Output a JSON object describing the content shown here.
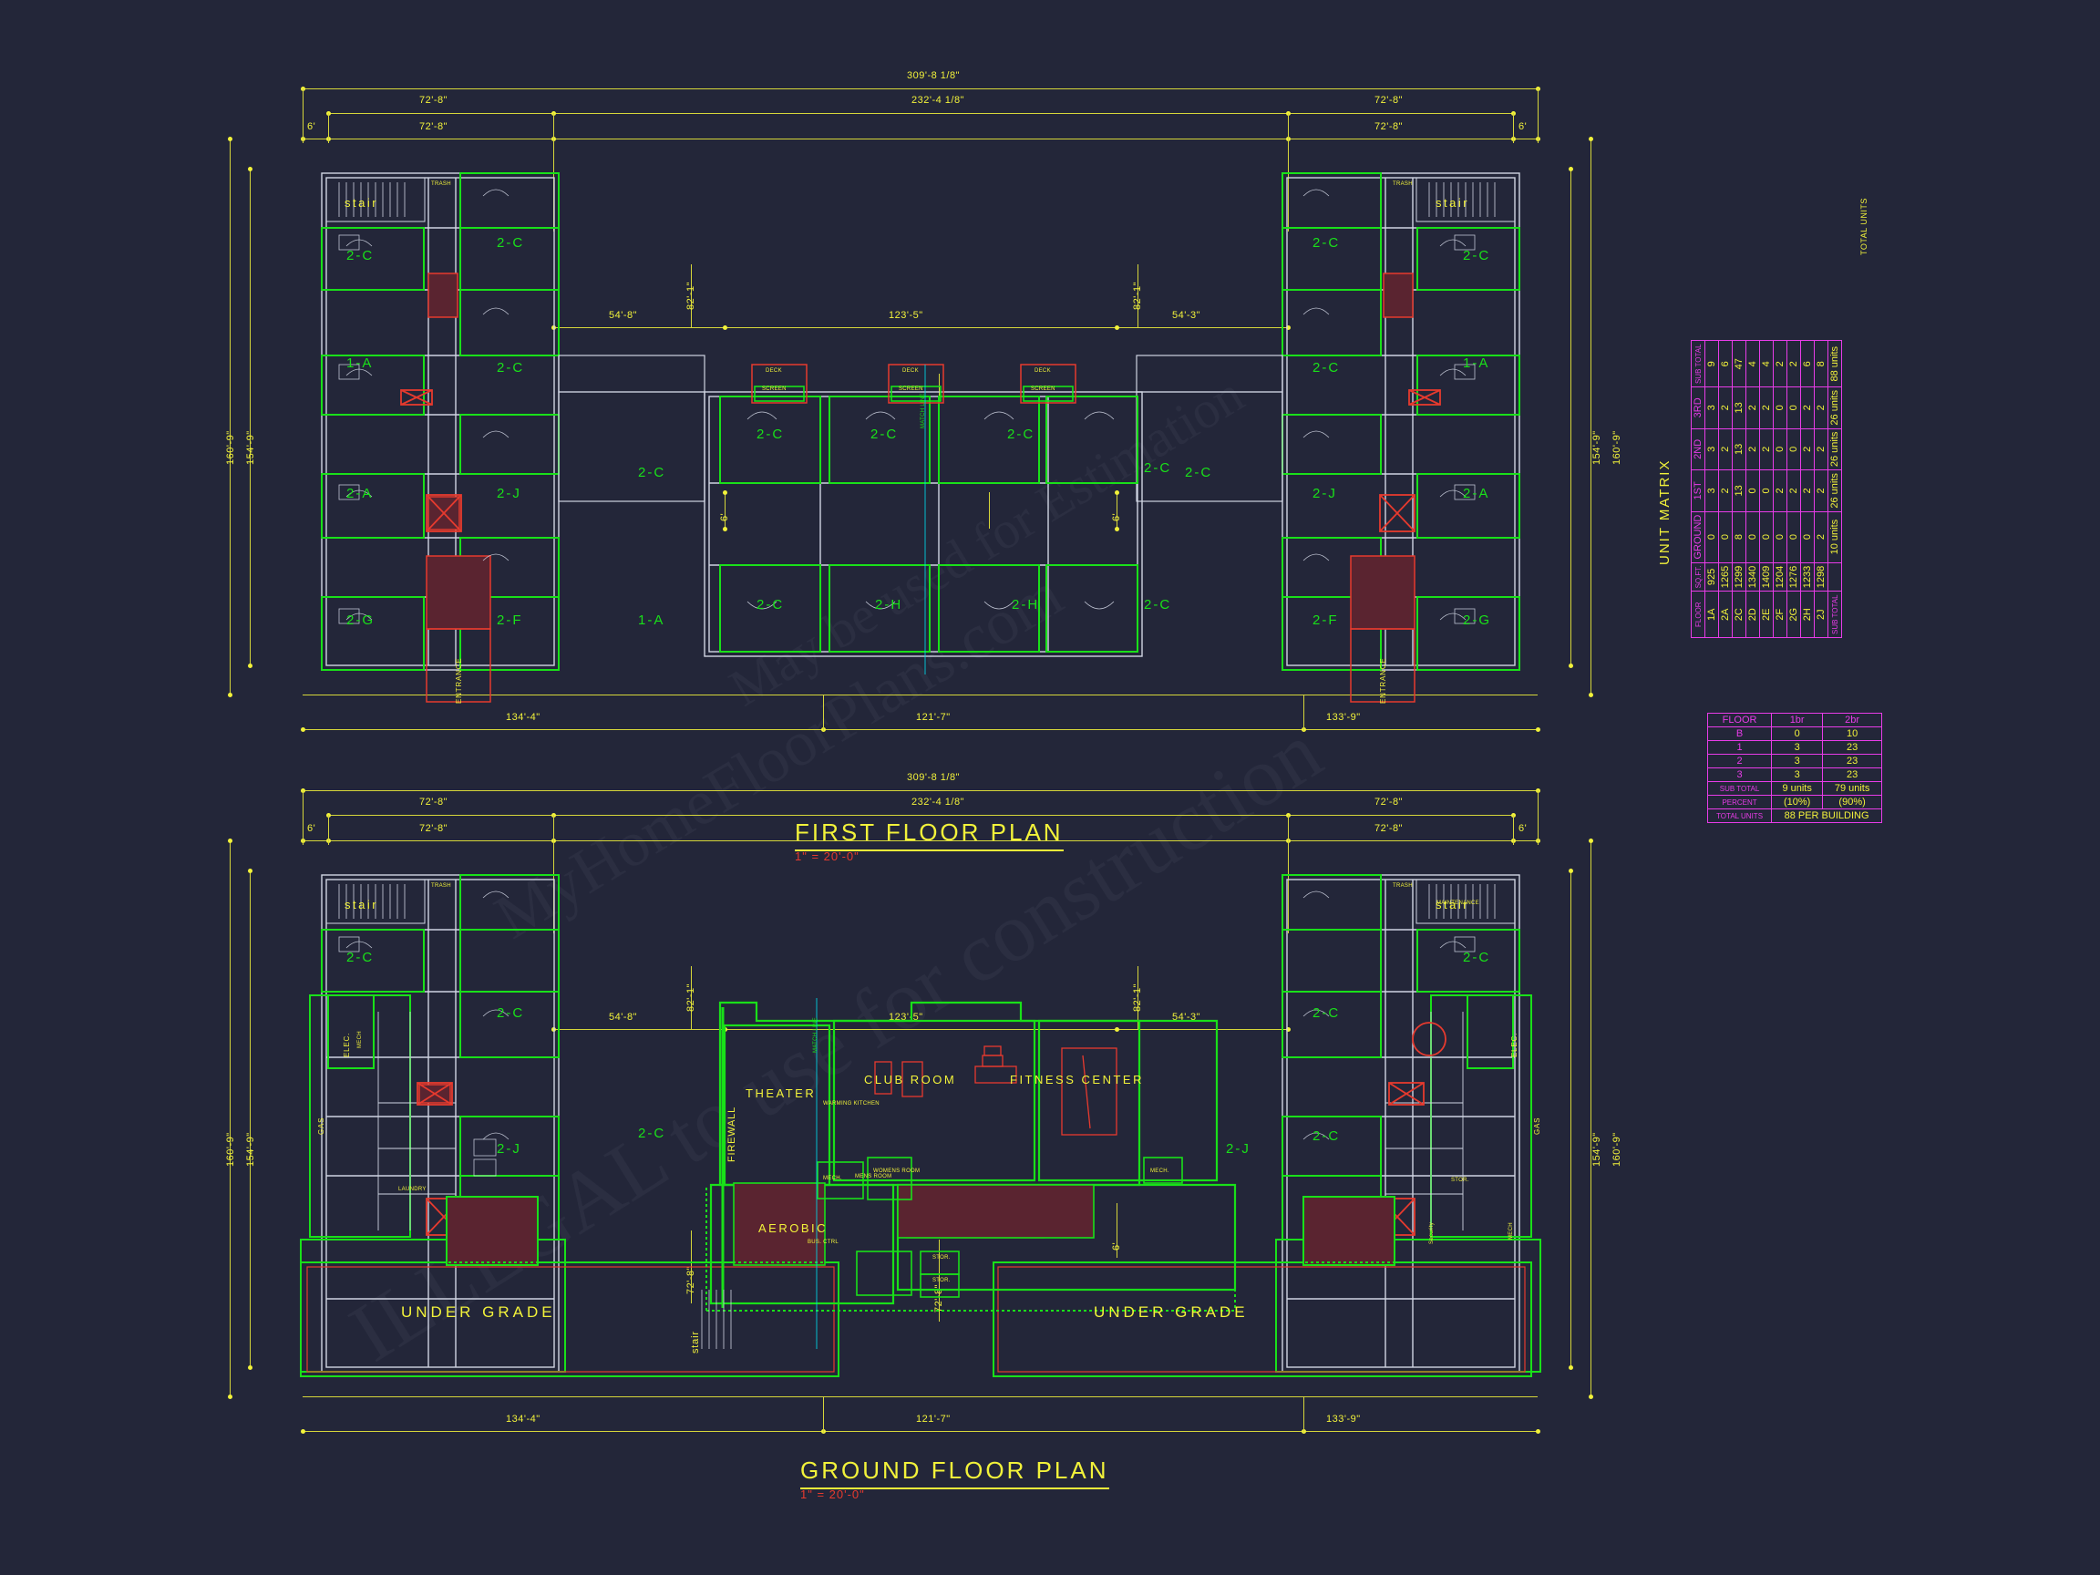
{
  "sheet": {
    "background_color": "#232639",
    "line_colors": {
      "dimension_yellow": "#f2f23a",
      "unit_green": "#19e019",
      "detail_red": "#e63a2e",
      "wall_white": "#cfd4e2",
      "table_magenta": "#e83ce8",
      "match_cyan": "#00d8e8"
    }
  },
  "watermark": {
    "line1": "MyHomeFloorPlans.com",
    "line2": "ILLEGAL to use for construction",
    "line3": "May be used for Estimation"
  },
  "plans": [
    {
      "id": "first-floor",
      "title": "FIRST FLOOR PLAN",
      "scale": "1\" = 20'-0\"",
      "dimensions": {
        "overall_top": "309'-8 1/8\"",
        "inner_top": "232'-4 1/8\"",
        "left_wing_top": "72'-8\"",
        "right_wing_top": "72'-8\"",
        "offset": "6'",
        "left_height_outer": "160'-9\"",
        "left_height_inner": "154'-9\"",
        "right_height_outer": "160'-9\"",
        "right_height_inner": "154'-9\"",
        "center_left": "54'-8\"",
        "center_mid": "123'-5\"",
        "center_right": "54'-3\"",
        "wing_depth_left": "82'-1\"",
        "wing_depth_right": "82'-1\"",
        "bottom_left": "134'-4\"",
        "bottom_mid": "121'-7\"",
        "bottom_right": "133'-9\""
      },
      "unit_labels_left": [
        "2-C",
        "2-C",
        "1-A",
        "2-C",
        "2-A",
        "2-J",
        "2-C",
        "2-G",
        "2-F",
        "1-A"
      ],
      "unit_labels_right": [
        "2-C",
        "2-C",
        "1-A",
        "2-C",
        "2-A",
        "2-J",
        "2-C",
        "2-F",
        "2-G"
      ],
      "unit_labels_center": [
        "2-C",
        "2-C",
        "2-C",
        "2-C",
        "2-C",
        "2-H",
        "2-H",
        "2-C"
      ],
      "room_labels": [
        "stair",
        "TRASH",
        "DECK",
        "SCREEN",
        "ENTRANCE",
        "stair",
        "TRASH",
        "ENTRANCE"
      ]
    },
    {
      "id": "ground-floor",
      "title": "GROUND FLOOR PLAN",
      "scale": "1\" = 20'-0\"",
      "dimensions": {
        "overall_top": "309'-8 1/8\"",
        "inner_top": "232'-4 1/8\"",
        "left_wing_top": "72'-8\"",
        "right_wing_top": "72'-8\"",
        "offset": "6'",
        "left_height_outer": "160'-9\"",
        "left_height_inner": "154'-9\"",
        "right_height_outer": "160'-9\"",
        "right_height_inner": "154'-9\"",
        "center_left": "54'-8\"",
        "center_mid": "123'-5\"",
        "center_right": "54'-3\"",
        "wing_depth_left": "82'-1\"",
        "wing_depth_right": "82'-1\"",
        "inner_offset": "72'-8\"",
        "bottom_left": "134'-4\"",
        "bottom_mid": "121'-7\"",
        "bottom_right": "133'-9\""
      },
      "unit_labels_left": [
        "2-C",
        "2-C",
        "2-J",
        "2-C"
      ],
      "unit_labels_right": [
        "2-C",
        "2-C",
        "2-C",
        "2-J"
      ],
      "amenities": [
        "THEATER",
        "CLUB ROOM",
        "FITNESS CENTER",
        "AEROBIC"
      ],
      "service_labels_left": [
        "ELEC.",
        "GAS",
        "MECH",
        "LAUNDRY",
        "TRASH",
        "stair",
        "TRASH"
      ],
      "service_labels_right": [
        "MAINTENANCE",
        "ELEC.",
        "GAS",
        "STOR.",
        "Security",
        "MECH"
      ],
      "center_labels": [
        "FIREWALL",
        "BUS. CTRL",
        "STOR.",
        "STOR.",
        "MECH.",
        "MECH.",
        "WARMING KITCHEN",
        "MENS ROOM",
        "WOMENS ROOM",
        "MATCH LINE"
      ],
      "undergrade_left": "UNDER GRADE",
      "undergrade_right": "UNDER GRADE"
    }
  ],
  "unit_matrix": {
    "title": "UNIT MATRIX",
    "headers": [
      "FLOOR",
      "SQ.FT.",
      "GROUND",
      "1ST",
      "2ND",
      "3RD",
      "SUB TOTAL"
    ],
    "rows": [
      {
        "type": "1A",
        "sqft": "925",
        "ground": "0",
        "first": "3",
        "second": "3",
        "third": "3",
        "subtotal": "9"
      },
      {
        "type": "2A",
        "sqft": "1265",
        "ground": "0",
        "first": "2",
        "second": "2",
        "third": "2",
        "subtotal": "6"
      },
      {
        "type": "2C",
        "sqft": "1299",
        "ground": "8",
        "first": "13",
        "second": "13",
        "third": "13",
        "subtotal": "47"
      },
      {
        "type": "2D",
        "sqft": "1340",
        "ground": "0",
        "first": "0",
        "second": "2",
        "third": "2",
        "subtotal": "4"
      },
      {
        "type": "2E",
        "sqft": "1409",
        "ground": "0",
        "first": "0",
        "second": "2",
        "third": "2",
        "subtotal": "4"
      },
      {
        "type": "2F",
        "sqft": "1204",
        "ground": "0",
        "first": "2",
        "second": "0",
        "third": "0",
        "subtotal": "2"
      },
      {
        "type": "2G",
        "sqft": "1276",
        "ground": "0",
        "first": "2",
        "second": "0",
        "third": "0",
        "subtotal": "2"
      },
      {
        "type": "2H",
        "sqft": "1233",
        "ground": "0",
        "first": "2",
        "second": "2",
        "third": "2",
        "subtotal": "6"
      },
      {
        "type": "2J",
        "sqft": "1298",
        "ground": "2",
        "first": "2",
        "second": "2",
        "third": "2",
        "subtotal": "8"
      }
    ],
    "totals_row_label": "SUB TOTAL",
    "totals": {
      "ground": "10 units",
      "first": "26 units",
      "second": "26 units",
      "third": "26 units",
      "grand": "88 units",
      "grand_label": "TOTAL UNITS"
    }
  },
  "bedroom_matrix": {
    "headers": [
      "FLOOR",
      "1br",
      "2br"
    ],
    "rows": [
      {
        "floor": "B",
        "one_br": "0",
        "two_br": "10"
      },
      {
        "floor": "1",
        "one_br": "3",
        "two_br": "23"
      },
      {
        "floor": "2",
        "one_br": "3",
        "two_br": "23"
      },
      {
        "floor": "3",
        "one_br": "3",
        "two_br": "23"
      }
    ],
    "subtotal_label": "SUB TOTAL",
    "subtotal_1br": "9 units",
    "subtotal_2br": "79 units",
    "percent_label": "PERCENT",
    "percent_1br": "(10%)",
    "percent_2br": "(90%)",
    "total_label": "TOTAL UNITS",
    "total_value": "88 PER BUILDING"
  }
}
